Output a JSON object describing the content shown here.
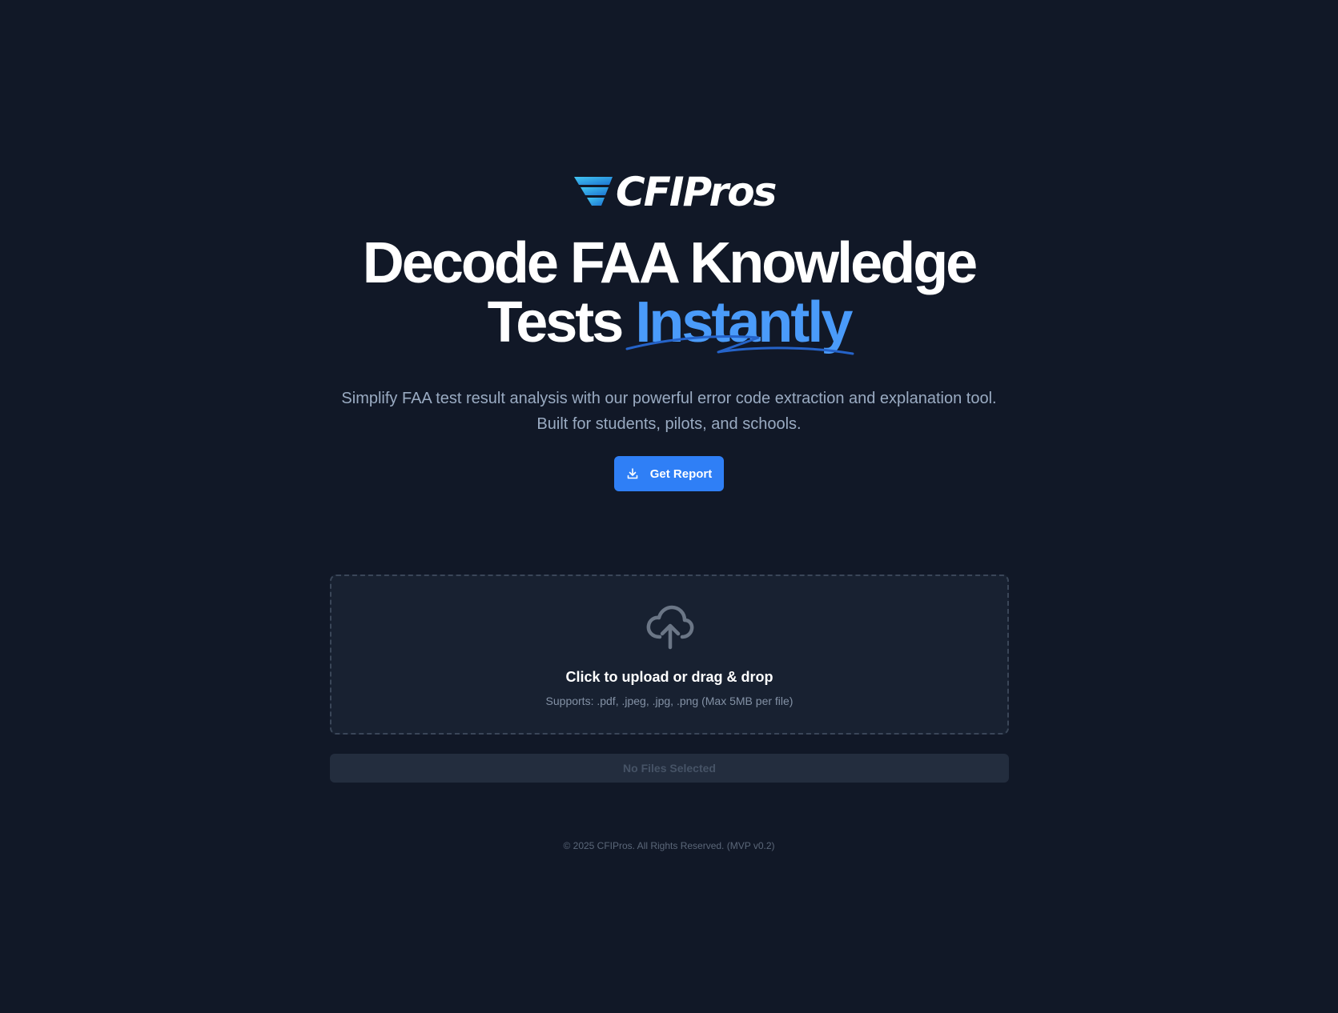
{
  "brand": {
    "logo_text": "CFIPros",
    "colors": {
      "wing_light": "#3fc1f0",
      "wing_dark": "#1f7fd6"
    }
  },
  "hero": {
    "headline_line1": "Decode FAA Knowledge",
    "headline_line2_prefix": "Tests",
    "headline_accent": "Instantly",
    "subtitle_line1": "Simplify FAA test result analysis with our powerful error code extraction and explanation tool.",
    "subtitle_line2": "Built for students, pilots, and schools."
  },
  "cta": {
    "label": "Get Report",
    "icon": "download-icon",
    "color": "#2f7ff6"
  },
  "upload": {
    "icon": "cloud-upload-icon",
    "title": "Click to upload or drag & drop",
    "supports": "Supports: .pdf, .jpeg, .jpg, .png (Max 5MB per file)",
    "status": "No Files Selected"
  },
  "footer": {
    "copyright": "© 2025 CFIPros. All Rights Reserved. (MVP v0.2)"
  },
  "colors": {
    "background": "#111827",
    "accent": "#4a9bfa",
    "dropzone_bg": "#182131"
  }
}
